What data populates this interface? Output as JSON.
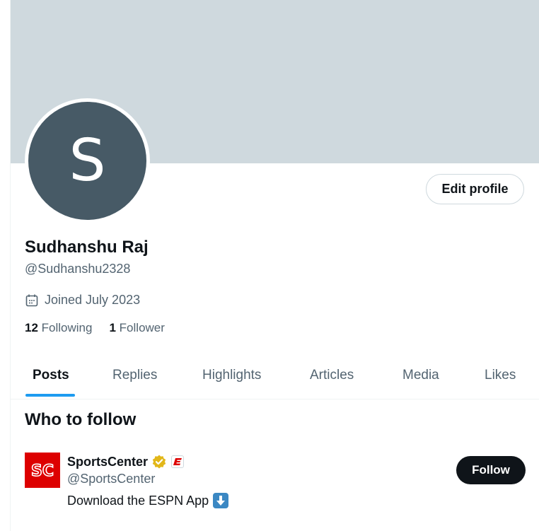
{
  "profile": {
    "avatar_letter": "S",
    "edit_label": "Edit profile",
    "name": "Sudhanshu Raj",
    "handle": "@Sudhanshu2328",
    "joined": "Joined July 2023",
    "following_count": "12",
    "following_label": "Following",
    "followers_count": "1",
    "followers_label": "Follower"
  },
  "tabs": [
    {
      "label": "Posts",
      "active": true
    },
    {
      "label": "Replies"
    },
    {
      "label": "Highlights"
    },
    {
      "label": "Articles"
    },
    {
      "label": "Media"
    },
    {
      "label": "Likes"
    }
  ],
  "who_to_follow": {
    "title": "Who to follow",
    "account": {
      "name": "SportsCenter",
      "handle": "@SportsCenter",
      "bio": "Download the ESPN App",
      "follow_label": "Follow",
      "logo_text": "SC"
    }
  },
  "colors": {
    "banner": "#cfd9de",
    "avatar": "#475a66",
    "accent": "#1d9bf0",
    "verified_gold": "#e2b719",
    "espn_red": "#d00"
  },
  "icons": [
    "calendar-icon",
    "verified-gold-icon",
    "espn-affiliate-icon",
    "down-arrow-emoji"
  ]
}
